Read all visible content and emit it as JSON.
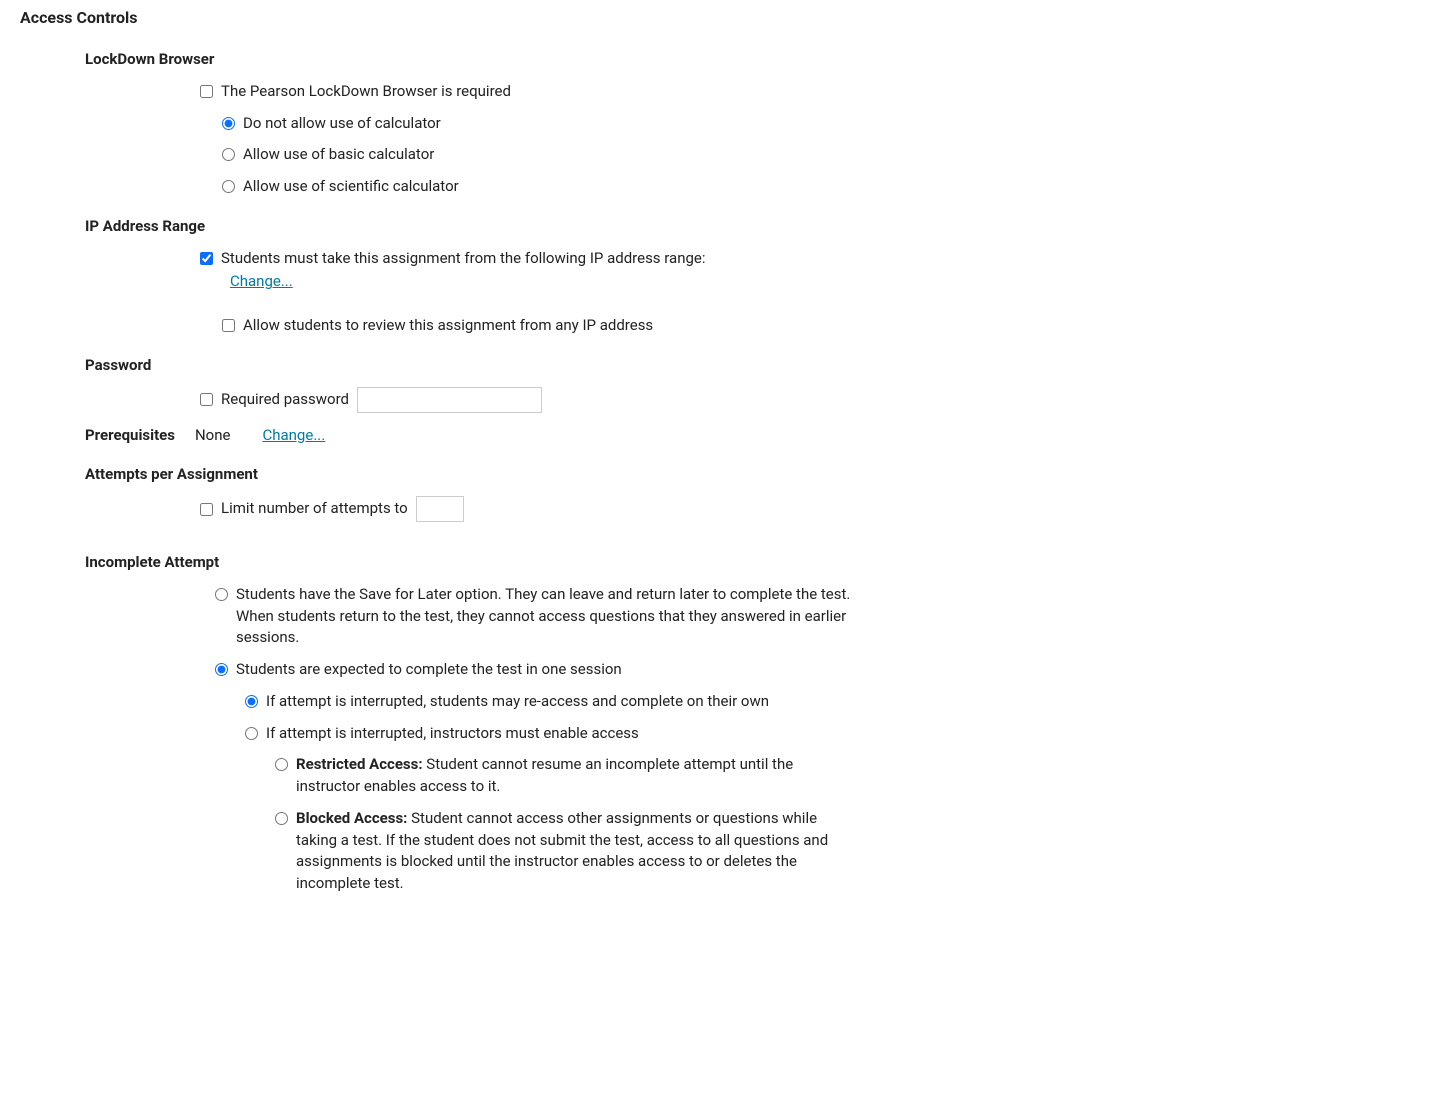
{
  "title": "Access Controls",
  "lockdown": {
    "heading": "LockDown Browser",
    "required": "The Pearson LockDown Browser is required",
    "opt_no_calc": "Do not allow use of calculator",
    "opt_basic_calc": "Allow use of basic calculator",
    "opt_sci_calc": "Allow use of scientific calculator"
  },
  "ip": {
    "heading": "IP Address Range",
    "must_take": "Students must take this assignment from the following IP address range:",
    "change": "Change...",
    "allow_review": "Allow students to review this assignment from any IP address"
  },
  "password": {
    "heading": "Password",
    "required": "Required password",
    "value": ""
  },
  "prereq": {
    "heading": "Prerequisites",
    "none": "None",
    "change": "Change..."
  },
  "attempts": {
    "heading": "Attempts per Assignment",
    "limit": "Limit number of attempts to",
    "value": ""
  },
  "incomplete": {
    "heading": "Incomplete Attempt",
    "save_for_later": "Students have the Save for Later option. They can leave and return later to complete the test. When students return to the test, they cannot access questions that they answered in earlier sessions.",
    "one_session": "Students are expected to complete the test in one session",
    "interrupted_reaccess": "If attempt is interrupted, students may re-access and complete on their own",
    "interrupted_instructor": "If attempt is interrupted, instructors must enable access",
    "restricted_label": "Restricted Access:",
    "restricted_body": " Student cannot resume an incomplete attempt until the instructor enables access to it.",
    "blocked_label": "Blocked Access:",
    "blocked_body": " Student cannot access other assignments or questions while taking a test. If the student does not submit the test, access to all questions and assignments is blocked until the instructor enables access to or deletes the incomplete test."
  }
}
